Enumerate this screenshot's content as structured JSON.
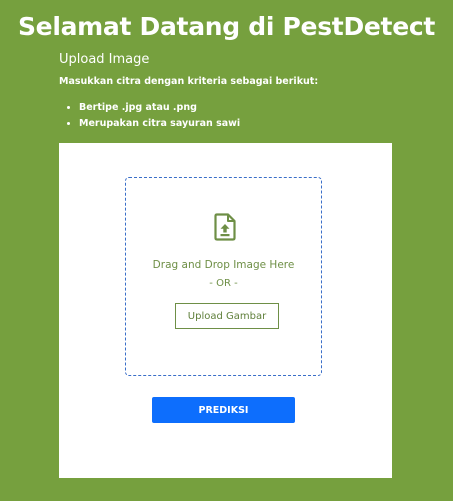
{
  "header": {
    "title": "Selamat Datang di PestDetect"
  },
  "upload_section": {
    "title": "Upload Image",
    "instruction": "Masukkan citra dengan kriteria sebagai berikut:",
    "criteria": [
      "Bertipe .jpg atau .png",
      "Merupakan citra sayuran sawi"
    ]
  },
  "dropzone": {
    "icon": "file-upload-icon",
    "drag_text": "Drag and Drop Image Here",
    "or_text": "- OR -",
    "upload_button_label": "Upload Gambar"
  },
  "actions": {
    "predict_label": "PREDIKSI"
  },
  "colors": {
    "page_background": "#76a03e",
    "card_background": "#ffffff",
    "dropzone_border": "#3a6ec8",
    "accent_text": "#6e8f46",
    "predict_button": "#0d6efd"
  }
}
